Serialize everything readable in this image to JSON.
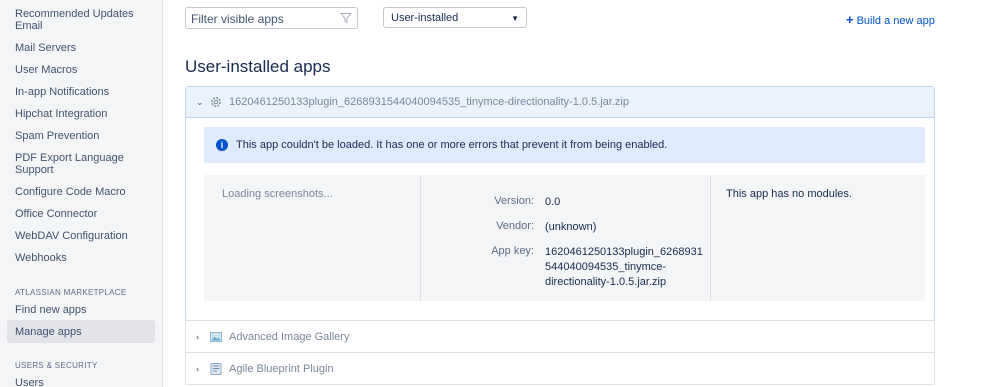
{
  "sidebar": {
    "items": [
      {
        "label": "Recommended Updates Email"
      },
      {
        "label": "Mail Servers"
      },
      {
        "label": "User Macros"
      },
      {
        "label": "In-app Notifications"
      },
      {
        "label": "Hipchat Integration"
      },
      {
        "label": "Spam Prevention"
      },
      {
        "label": "PDF Export Language Support"
      },
      {
        "label": "Configure Code Macro"
      },
      {
        "label": "Office Connector"
      },
      {
        "label": "WebDAV Configuration"
      },
      {
        "label": "Webhooks"
      }
    ],
    "marketplace_title": "ATLASSIAN MARKETPLACE",
    "marketplace_items": [
      {
        "label": "Find new apps"
      },
      {
        "label": "Manage apps",
        "active": true
      }
    ],
    "security_title": "USERS & SECURITY",
    "security_items": [
      {
        "label": "Users"
      }
    ]
  },
  "toolbar": {
    "filter_placeholder": "Filter visible apps",
    "filter_icon": "funnel-icon",
    "select_value": "User-installed",
    "build_label": "Build a new app"
  },
  "page_title": "User-installed apps",
  "expanded_app": {
    "name": "1620461250133plugin_6268931544040094535_tinymce-directionality-1.0.5.jar.zip",
    "icon": "gear-icon",
    "message": "This app couldn't be loaded. It has one or more errors that prevent it from being enabled.",
    "loading_text": "Loading screenshots...",
    "version_label": "Version:",
    "version_value": "0.0",
    "vendor_label": "Vendor:",
    "vendor_value": "(unknown)",
    "appkey_label": "App key:",
    "appkey_line1": "1620461250133plugin_6268931",
    "appkey_line2": "544040094535_tinymce-",
    "appkey_line3": "directionality-1.0.5.jar.zip",
    "modules_text": "This app has no modules."
  },
  "apps": [
    {
      "name": "Advanced Image Gallery",
      "icon": "image-gallery-icon"
    },
    {
      "name": "Agile Blueprint Plugin",
      "icon": "blueprint-icon"
    }
  ],
  "colors": {
    "accent": "#0052cc",
    "info_bg": "#deebff",
    "expanded_header_bg": "#eaf2fb"
  }
}
